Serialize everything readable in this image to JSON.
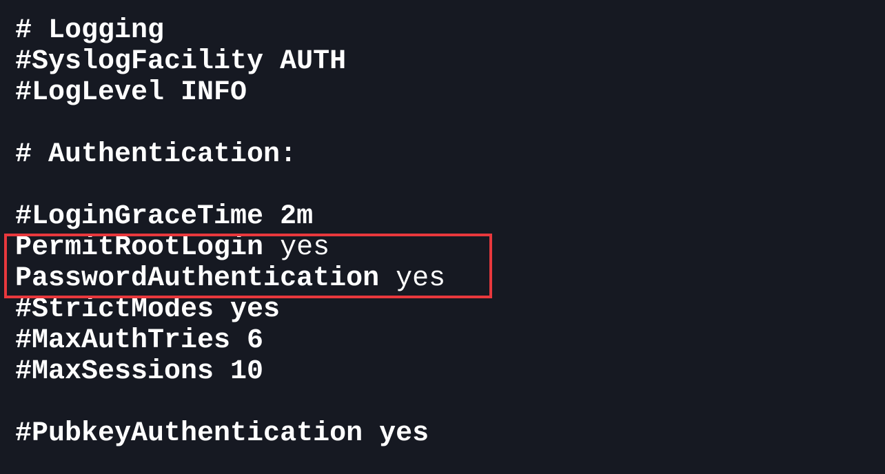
{
  "lines": [
    {
      "text": "# Logging"
    },
    {
      "text": "#SyslogFacility AUTH"
    },
    {
      "text": "#LogLevel INFO"
    },
    {
      "text": ""
    },
    {
      "text": "# Authentication:"
    },
    {
      "text": ""
    },
    {
      "text": "#LoginGraceTime 2m"
    },
    {
      "key": "PermitRootLogin",
      "value": "yes"
    },
    {
      "key": "PasswordAuthentication",
      "value": "yes"
    },
    {
      "text": "#StrictModes yes"
    },
    {
      "text": "#MaxAuthTries 6"
    },
    {
      "text": "#MaxSessions 10"
    },
    {
      "text": ""
    },
    {
      "text": "#PubkeyAuthentication yes"
    }
  ],
  "colors": {
    "background": "#161922",
    "text": "#ffffff",
    "highlight": "#e8383d"
  }
}
